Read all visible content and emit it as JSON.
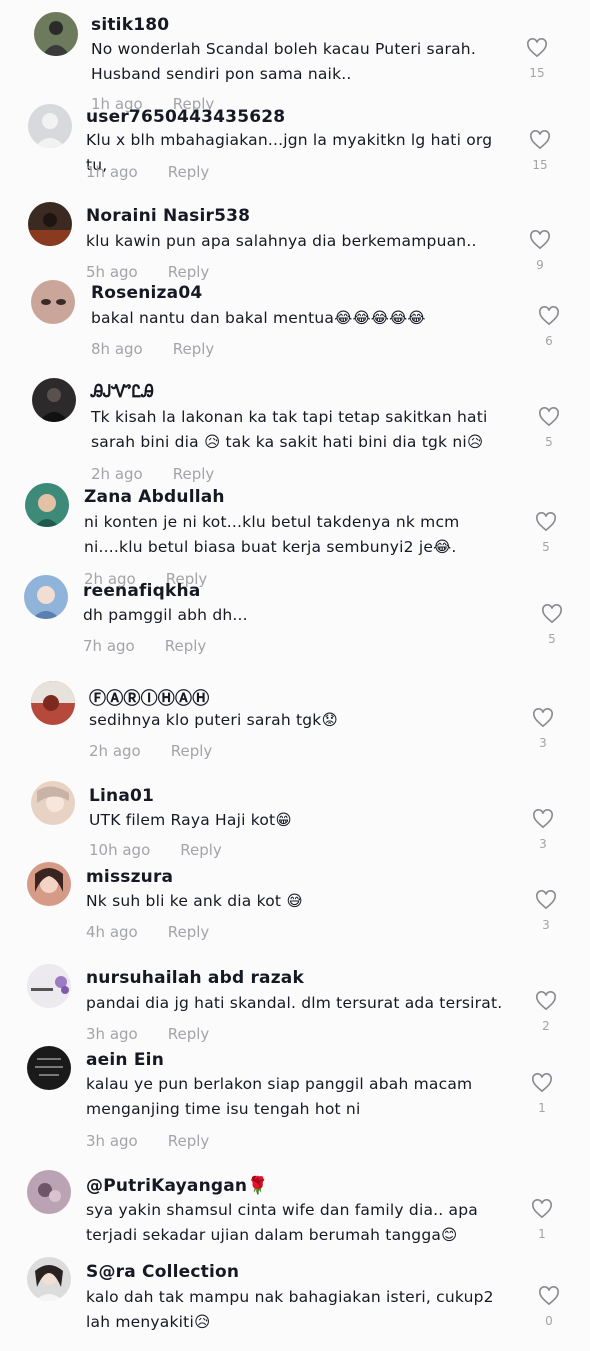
{
  "comments": [
    {
      "username": "sitik180",
      "text": "No wonderlah Scandal boleh kacau Puteri sarah. Husband sendiri pon sama naik..",
      "time": "1h ago",
      "reply": "Reply",
      "likes": "15",
      "avatar": "#6d7a5c"
    },
    {
      "username": "user7650443435628",
      "text": "Klu x blh mbahagiakan...jgn la myakitkn lg hati org tu,",
      "time": "1h ago",
      "reply": "Reply",
      "likes": "15",
      "avatar": "#d8d9dc"
    },
    {
      "username": "Noraini Nasir538",
      "text": "klu kawin pun apa salahnya dia berkemampuan..",
      "time": "5h ago",
      "reply": "Reply",
      "likes": "9",
      "avatar": "#3b2a22"
    },
    {
      "username": "Roseniza04",
      "text": "bakal nantu dan bakal mentua😂😂😂😂😂",
      "time": "8h ago",
      "reply": "Reply",
      "likes": "6",
      "avatar": "#c9a59a"
    },
    {
      "username": "ᎯᎫᏉᏝᎯ",
      "text": "Tk kisah la lakonan ka tak tapi tetap sakitkan hati sarah bini dia 😥 tak ka sakit hati bini dia tgk ni😥",
      "time": "2h ago",
      "reply": "Reply",
      "likes": "5",
      "avatar": "#2d2a2b"
    },
    {
      "username": "Zana Abdullah",
      "text": "ni konten je ni kot...klu betul takdenya nk mcm ni....klu betul biasa buat kerja sembunyi2 je😂.",
      "time": "2h ago",
      "reply": "Reply",
      "likes": "5",
      "avatar": "#3d8a78"
    },
    {
      "username": "reenafiqkha",
      "text": "dh pamggil abh dh...",
      "time": "7h ago",
      "reply": "Reply",
      "likes": "5",
      "avatar": "#8fb3d9"
    },
    {
      "username": "ⒻⒶⓇⒾⒽⒶⒽ",
      "text": "sedihnya klo puteri sarah tgk😟",
      "time": "2h ago",
      "reply": "Reply",
      "likes": "3",
      "avatar": "#b54a3c"
    },
    {
      "username": "Lina01",
      "text": "UTK filem Raya Haji kot😁",
      "time": "10h ago",
      "reply": "Reply",
      "likes": "3",
      "avatar": "#e8d2c4"
    },
    {
      "username": "misszura",
      "text": "Nk suh bli ke ank dia kot 😅",
      "time": "4h ago",
      "reply": "Reply",
      "likes": "3",
      "avatar": "#d59b86"
    },
    {
      "username": "nursuhailah abd razak",
      "text": "pandai dia jg hati skandal. dlm tersurat ada tersirat.",
      "time": "3h ago",
      "reply": "Reply",
      "likes": "2",
      "avatar": "#ece9ef"
    },
    {
      "username": "aein Ein",
      "text": "kalau ye pun berlakon siap panggil abah macam menganjing time isu tengah hot ni",
      "time": "3h ago",
      "reply": "Reply",
      "likes": "1",
      "avatar": "#1a1a1a"
    },
    {
      "username": "@PutriKayangan🌹",
      "text": "sya yakin shamsul cinta wife dan family dia.. apa terjadi sekadar ujian dalam berumah tangga😊",
      "time": "",
      "reply": "",
      "likes": "1",
      "avatar": "#b9a3b4"
    },
    {
      "username": "S@ra Collection",
      "text": "kalo dah tak mampu nak bahagiakan isteri, cukup2 lah menyakiti😥",
      "time": "",
      "reply": "",
      "likes": "0",
      "avatar": "#dcdcdc"
    }
  ],
  "colors": {
    "text": "#161823",
    "meta": "#a3a4a8",
    "background": "#fbfbfb"
  }
}
